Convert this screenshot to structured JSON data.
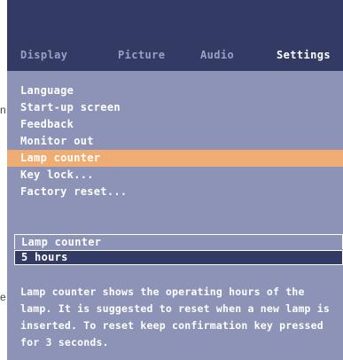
{
  "edge_fragments": [
    "n",
    "e"
  ],
  "tabs": [
    {
      "label": "Display",
      "active": false
    },
    {
      "label": "Picture",
      "active": false
    },
    {
      "label": "Audio",
      "active": false
    },
    {
      "label": "Settings",
      "active": true
    }
  ],
  "menu": {
    "items": [
      {
        "label": "Language"
      },
      {
        "label": "Start-up screen"
      },
      {
        "label": "Feedback"
      },
      {
        "label": "Monitor out"
      },
      {
        "label": "Lamp counter",
        "selected": true
      },
      {
        "label": "Key lock..."
      },
      {
        "label": "Factory reset..."
      }
    ]
  },
  "detail": {
    "label": "Lamp counter",
    "value": "5 hours"
  },
  "help": {
    "lines": [
      "Lamp counter shows the operating hours of the",
      "lamp. It is suggested to reset when a new lamp is",
      "inserted. To reset keep confirmation key pressed",
      "for 3 seconds."
    ]
  },
  "colors": {
    "header_bg": "#333a63",
    "panel_bg": "#8c93b6",
    "highlight": "#f0ad73",
    "text": "#ffffff"
  }
}
